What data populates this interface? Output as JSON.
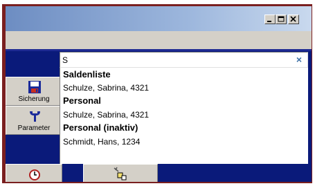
{
  "window": {
    "caption_buttons": [
      "minimize",
      "maximize",
      "close"
    ]
  },
  "search": {
    "value": "S",
    "clear_label": "×"
  },
  "toolbar": {
    "sicherung_label": "Sicherung",
    "parameter_label": "Parameter"
  },
  "results": [
    {
      "type": "header",
      "text": "Saldenliste"
    },
    {
      "type": "entry",
      "text": "Schulze, Sabrina, 4321"
    },
    {
      "type": "header",
      "text": "Personal"
    },
    {
      "type": "entry",
      "text": "Schulze, Sabrina, 4321"
    },
    {
      "type": "header",
      "text": "Personal (inaktiv)"
    },
    {
      "type": "entry",
      "text": "Schmidt, Hans, 1234"
    }
  ],
  "colors": {
    "frame": "#7a1f1f",
    "navy": "#0a1a7a",
    "titlebar": "#9db7dd"
  },
  "icons": [
    "floppy-disk-icon",
    "wrench-icon",
    "clock-icon",
    "eraser-icon"
  ]
}
